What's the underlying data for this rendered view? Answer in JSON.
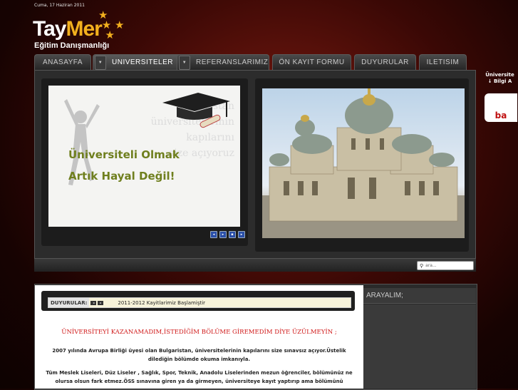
{
  "header": {
    "date": "Cuma, 17 Haziran 2011"
  },
  "logo": {
    "brand_a": "Tay",
    "brand_b": "Mer",
    "tagline": "Eğitim Danışmanlığı"
  },
  "nav": {
    "items": [
      {
        "label": "ANASAYFA"
      },
      {
        "label": "UNIVERSITELER"
      },
      {
        "label": "REFERANSLARIMIZ"
      },
      {
        "label": "ÖN KAYIT FORMU"
      },
      {
        "label": "DUYURULAR"
      },
      {
        "label": "ILETISIM"
      }
    ]
  },
  "slider": {
    "line1": "Üniversiteli Olmak",
    "line2": "Artık Hayal Değil!",
    "faint_text": [
      "Bulgaristan",
      "üniversitelerinin",
      "kapılarını",
      "size açıyoruz"
    ]
  },
  "search": {
    "placeholder": "ara..."
  },
  "side_ad": {
    "line1": "Üniversite",
    "line2": "↓ Bilgi A",
    "badge": "ba"
  },
  "announcements": {
    "label": "DUYURULAR:",
    "text": "2011-2012 Kayitlarimiz Başlamiştir"
  },
  "content": {
    "title": "ÜNİVERSİTEYİ KAZANAMADIM,İSTEDİĞİM BÖLÜME GİREMEDİM DİYE ÜZÜLMEYİN ;",
    "p1": "2007 yılında Avrupa Birliği üyesi olan Bulgaristan, üniversitelerinin kapılarını size sınavsız açıyor.Üstelik dilediğin bölümde okuma imkanıyla.",
    "p2": "Tüm Meslek Liseleri, Düz Liseler , Sağlık, Spor, Teknik, Anadolu Liselerinden mezun öğrenciler, bölümünüz ne olursa olsun fark etmez.ÖSS sınavına giren ya da girmeyen, üniversiteye kayıt yaptırıp ama bölümünü"
  },
  "right_panel": {
    "title": "ARAYALIM;"
  },
  "colors": {
    "accent": "#f2b01e",
    "title_red": "#d01818",
    "slide_text": "#6f7f1e"
  }
}
